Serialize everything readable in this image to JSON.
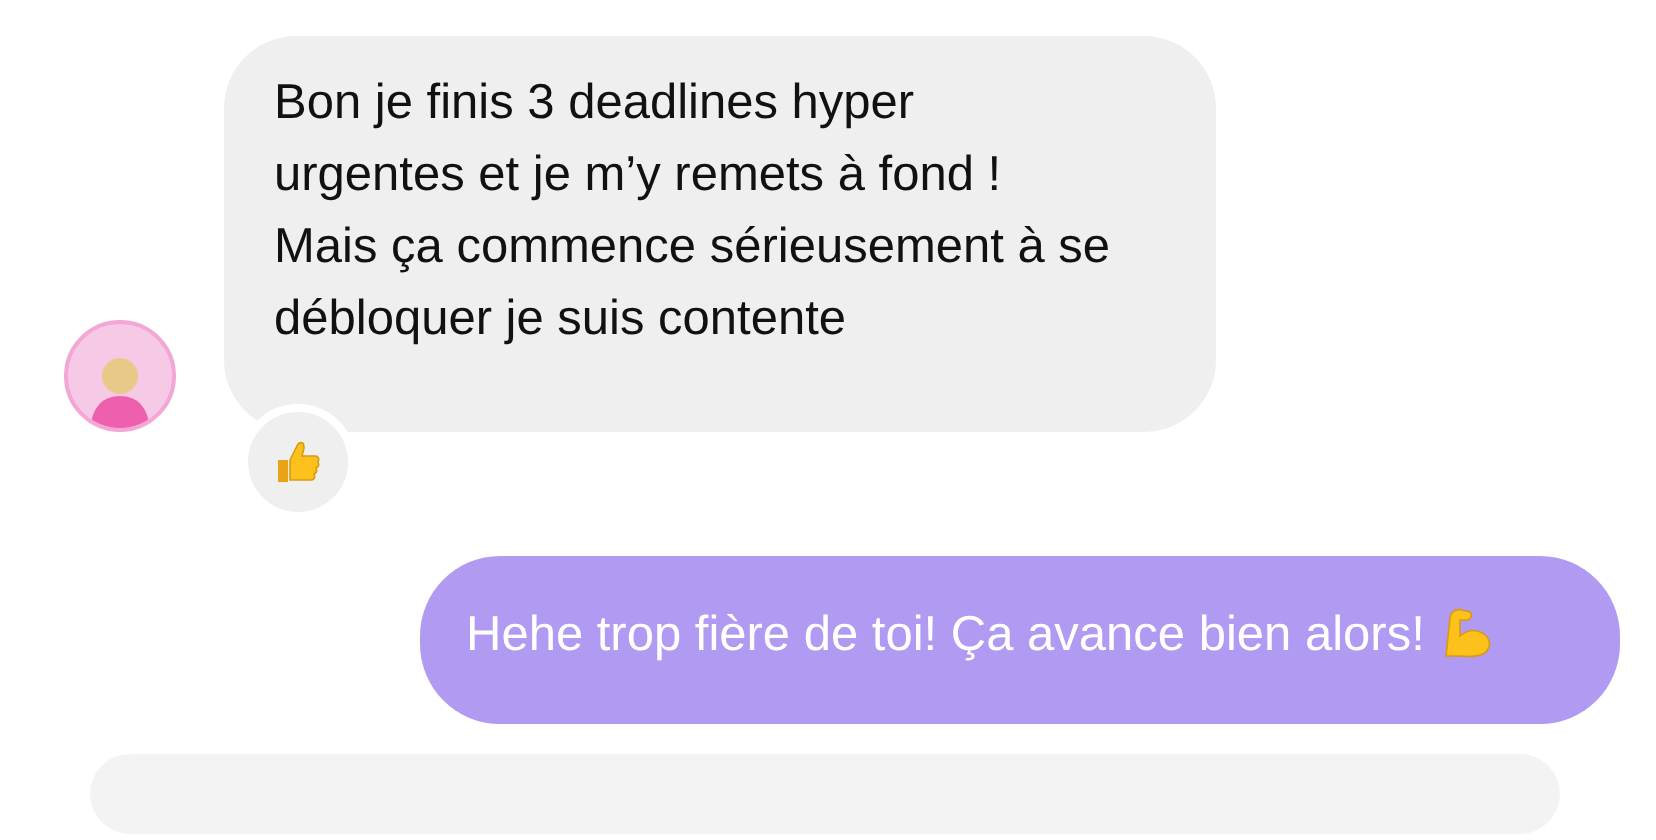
{
  "messages": [
    {
      "kind": "incoming",
      "text": "Bon je finis 3 deadlines hyper\nurgentes et je m’y remets à fond !\nMais ça commence sérieusement à se débloquer je suis contente",
      "avatar": true,
      "thumbs_up_reaction": true
    },
    {
      "kind": "outgoing",
      "text": "Hehe trop fière de toi! Ça avance bien alors!",
      "flexed_arm_emoji": true
    }
  ]
}
